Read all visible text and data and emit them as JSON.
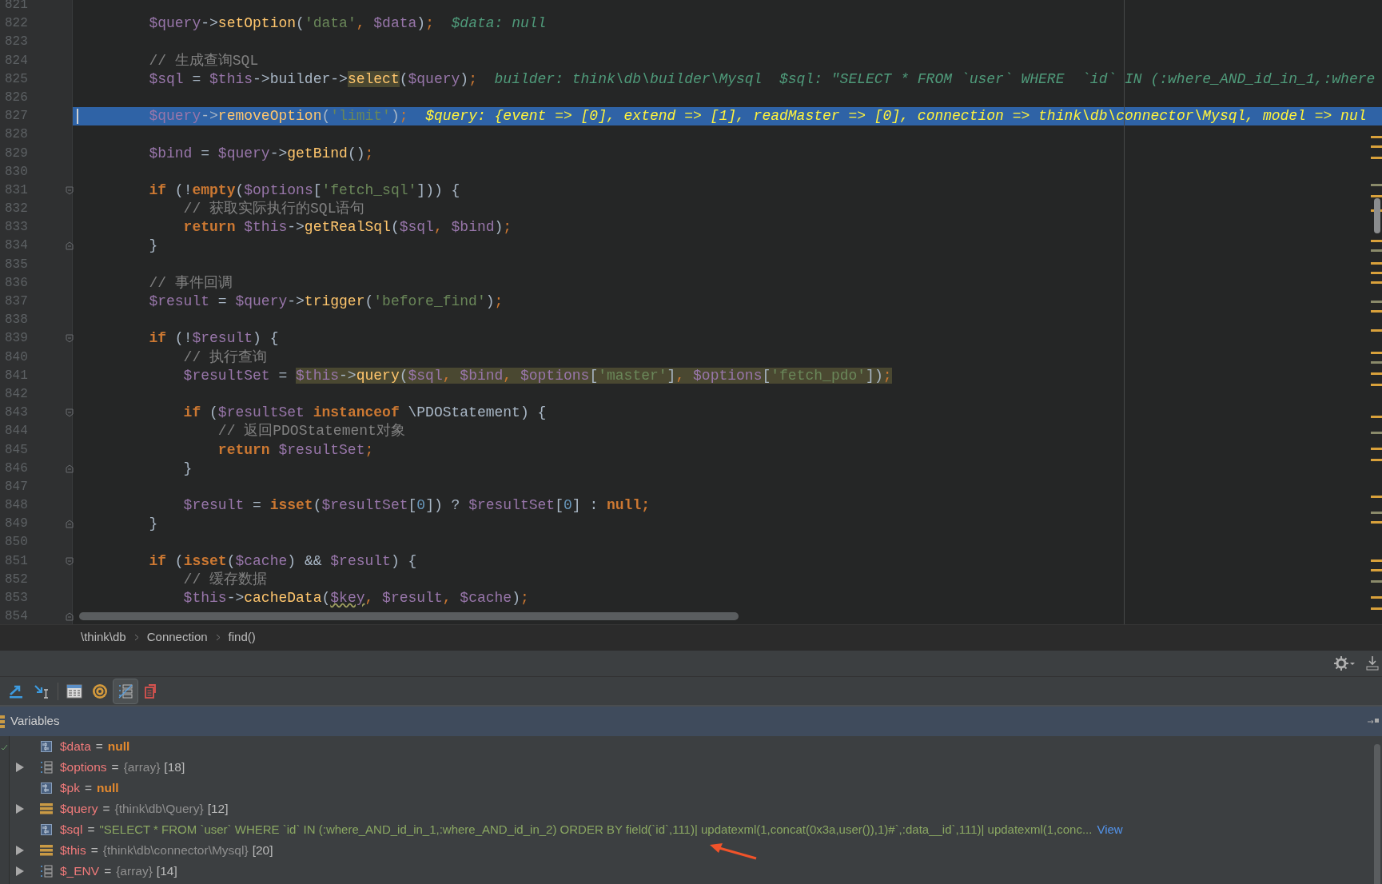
{
  "editor": {
    "lines": [
      {
        "number": "821",
        "current": false,
        "fold_start": false,
        "fold_end": false
      },
      {
        "number": "822",
        "current": false,
        "fold_start": false,
        "fold_end": false,
        "tokens": [
          {
            "kind": "var",
            "text": "        $query"
          },
          {
            "kind": "pl",
            "text": "->"
          },
          {
            "kind": "fn",
            "text": "setOption"
          },
          {
            "kind": "pl",
            "text": "("
          },
          {
            "kind": "str",
            "text": "'data'"
          },
          {
            "kind": "op",
            "text": ", "
          },
          {
            "kind": "var",
            "text": "$data"
          },
          {
            "kind": "pl",
            "text": ")"
          },
          {
            "kind": "op",
            "text": ";"
          }
        ],
        "hint": "$data: null"
      },
      {
        "number": "823",
        "current": false,
        "fold_start": false,
        "fold_end": false
      },
      {
        "number": "824",
        "current": false,
        "fold_start": false,
        "fold_end": false,
        "tokens": [
          {
            "kind": "cm",
            "text": "        // 生成查询SQL"
          }
        ]
      },
      {
        "number": "825",
        "current": false,
        "fold_start": false,
        "fold_end": false,
        "tokens": [
          {
            "kind": "var",
            "text": "        $sql"
          },
          {
            "kind": "pl",
            "text": " = "
          },
          {
            "kind": "var",
            "text": "$this"
          },
          {
            "kind": "pl",
            "text": "->builder->"
          },
          {
            "kind": "highlight",
            "tokens": [
              {
                "kind": "fn",
                "text": "select"
              }
            ]
          },
          {
            "kind": "pl",
            "text": "("
          },
          {
            "kind": "var",
            "text": "$query"
          },
          {
            "kind": "pl",
            "text": ")"
          },
          {
            "kind": "op",
            "text": ";"
          }
        ],
        "hint": "builder: think\\db\\builder\\Mysql  $sql: \"SELECT * FROM `user` WHERE  `id` IN (:where_AND_id_in_1,:where"
      },
      {
        "number": "826",
        "current": false,
        "fold_start": false,
        "fold_end": false
      },
      {
        "number": "827",
        "current": true,
        "fold_start": false,
        "fold_end": false,
        "tokens": [
          {
            "kind": "var",
            "text": "        $query"
          },
          {
            "kind": "pl",
            "text": "->"
          },
          {
            "kind": "fn",
            "text": "removeOption"
          },
          {
            "kind": "pl",
            "text": "("
          },
          {
            "kind": "str",
            "text": "'limit'"
          },
          {
            "kind": "pl",
            "text": ")"
          },
          {
            "kind": "op",
            "text": ";"
          }
        ],
        "hint": "$query: {event => [0], extend => [1], readMaster => [0], connection => think\\db\\connector\\Mysql, model => nul"
      },
      {
        "number": "828",
        "current": false,
        "fold_start": false,
        "fold_end": false
      },
      {
        "number": "829",
        "current": false,
        "fold_start": false,
        "fold_end": false,
        "tokens": [
          {
            "kind": "var",
            "text": "        $bind"
          },
          {
            "kind": "pl",
            "text": " = "
          },
          {
            "kind": "var",
            "text": "$query"
          },
          {
            "kind": "pl",
            "text": "->"
          },
          {
            "kind": "fn",
            "text": "getBind"
          },
          {
            "kind": "pl",
            "text": "()"
          },
          {
            "kind": "op",
            "text": ";"
          }
        ]
      },
      {
        "number": "830",
        "current": false,
        "fold_start": false,
        "fold_end": false
      },
      {
        "number": "831",
        "current": false,
        "fold_start": true,
        "fold_end": false,
        "tokens": [
          {
            "kind": "kw",
            "text": "        if"
          },
          {
            "kind": "pl",
            "text": " (!"
          },
          {
            "kind": "kw",
            "text": "empty"
          },
          {
            "kind": "pl",
            "text": "("
          },
          {
            "kind": "var",
            "text": "$options"
          },
          {
            "kind": "pl",
            "text": "["
          },
          {
            "kind": "str",
            "text": "'fetch_sql'"
          },
          {
            "kind": "pl",
            "text": "])) {"
          }
        ]
      },
      {
        "number": "832",
        "current": false,
        "fold_start": false,
        "fold_end": false,
        "tokens": [
          {
            "kind": "cm",
            "text": "            // 获取实际执行的SQL语句"
          }
        ]
      },
      {
        "number": "833",
        "current": false,
        "fold_start": false,
        "fold_end": false,
        "tokens": [
          {
            "kind": "kw",
            "text": "            return "
          },
          {
            "kind": "var",
            "text": "$this"
          },
          {
            "kind": "pl",
            "text": "->"
          },
          {
            "kind": "fn",
            "text": "getRealSql"
          },
          {
            "kind": "pl",
            "text": "("
          },
          {
            "kind": "var",
            "text": "$sql"
          },
          {
            "kind": "op",
            "text": ", "
          },
          {
            "kind": "var",
            "text": "$bind"
          },
          {
            "kind": "pl",
            "text": ")"
          },
          {
            "kind": "op",
            "text": ";"
          }
        ]
      },
      {
        "number": "834",
        "current": false,
        "fold_start": false,
        "fold_end": true,
        "tokens": [
          {
            "kind": "pl",
            "text": "        }"
          }
        ]
      },
      {
        "number": "835",
        "current": false,
        "fold_start": false,
        "fold_end": false
      },
      {
        "number": "836",
        "current": false,
        "fold_start": false,
        "fold_end": false,
        "tokens": [
          {
            "kind": "cm",
            "text": "        // 事件回调"
          }
        ]
      },
      {
        "number": "837",
        "current": false,
        "fold_start": false,
        "fold_end": false,
        "tokens": [
          {
            "kind": "var",
            "text": "        $result"
          },
          {
            "kind": "pl",
            "text": " = "
          },
          {
            "kind": "var",
            "text": "$query"
          },
          {
            "kind": "pl",
            "text": "->"
          },
          {
            "kind": "fn",
            "text": "trigger"
          },
          {
            "kind": "pl",
            "text": "("
          },
          {
            "kind": "str",
            "text": "'before_find'"
          },
          {
            "kind": "pl",
            "text": ")"
          },
          {
            "kind": "op",
            "text": ";"
          }
        ]
      },
      {
        "number": "838",
        "current": false,
        "fold_start": false,
        "fold_end": false
      },
      {
        "number": "839",
        "current": false,
        "fold_start": true,
        "fold_end": false,
        "tokens": [
          {
            "kind": "kw",
            "text": "        if"
          },
          {
            "kind": "pl",
            "text": " (!"
          },
          {
            "kind": "var",
            "text": "$result"
          },
          {
            "kind": "pl",
            "text": ") {"
          }
        ]
      },
      {
        "number": "840",
        "current": false,
        "fold_start": false,
        "fold_end": false,
        "tokens": [
          {
            "kind": "cm",
            "text": "            // 执行查询"
          }
        ]
      },
      {
        "number": "841",
        "current": false,
        "fold_start": false,
        "fold_end": false,
        "tokens": [
          {
            "kind": "var",
            "text": "            $resultSet"
          },
          {
            "kind": "pl",
            "text": " = "
          },
          {
            "kind": "highlight",
            "tokens": [
              {
                "kind": "var",
                "text": "$this"
              },
              {
                "kind": "pl",
                "text": "->"
              },
              {
                "kind": "fn",
                "text": "query"
              },
              {
                "kind": "pl",
                "text": "("
              },
              {
                "kind": "var",
                "text": "$sql"
              },
              {
                "kind": "op",
                "text": ", "
              },
              {
                "kind": "var",
                "text": "$bind"
              },
              {
                "kind": "op",
                "text": ", "
              },
              {
                "kind": "var",
                "text": "$options"
              },
              {
                "kind": "pl",
                "text": "["
              },
              {
                "kind": "str",
                "text": "'master'"
              },
              {
                "kind": "pl",
                "text": "]"
              },
              {
                "kind": "op",
                "text": ", "
              },
              {
                "kind": "var",
                "text": "$options"
              },
              {
                "kind": "pl",
                "text": "["
              },
              {
                "kind": "str",
                "text": "'fetch_pdo'"
              },
              {
                "kind": "pl",
                "text": "])"
              },
              {
                "kind": "op",
                "text": ";"
              }
            ]
          }
        ]
      },
      {
        "number": "842",
        "current": false,
        "fold_start": false,
        "fold_end": false
      },
      {
        "number": "843",
        "current": false,
        "fold_start": true,
        "fold_end": false,
        "tokens": [
          {
            "kind": "kw",
            "text": "            if"
          },
          {
            "kind": "pl",
            "text": " ("
          },
          {
            "kind": "var",
            "text": "$resultSet"
          },
          {
            "kind": "kw",
            "text": " instanceof "
          },
          {
            "kind": "pl",
            "text": "\\PDOStatement) {"
          }
        ]
      },
      {
        "number": "844",
        "current": false,
        "fold_start": false,
        "fold_end": false,
        "tokens": [
          {
            "kind": "cm",
            "text": "                // 返回PDOStatement对象"
          }
        ]
      },
      {
        "number": "845",
        "current": false,
        "fold_start": false,
        "fold_end": false,
        "tokens": [
          {
            "kind": "kw",
            "text": "                return "
          },
          {
            "kind": "var",
            "text": "$resultSet"
          },
          {
            "kind": "op",
            "text": ";"
          }
        ]
      },
      {
        "number": "846",
        "current": false,
        "fold_start": false,
        "fold_end": true,
        "tokens": [
          {
            "kind": "pl",
            "text": "            }"
          }
        ]
      },
      {
        "number": "847",
        "current": false,
        "fold_start": false,
        "fold_end": false
      },
      {
        "number": "848",
        "current": false,
        "fold_start": false,
        "fold_end": false,
        "tokens": [
          {
            "kind": "var",
            "text": "            $result"
          },
          {
            "kind": "pl",
            "text": " = "
          },
          {
            "kind": "kw",
            "text": "isset"
          },
          {
            "kind": "pl",
            "text": "("
          },
          {
            "kind": "var",
            "text": "$resultSet"
          },
          {
            "kind": "pl",
            "text": "["
          },
          {
            "kind": "num",
            "text": "0"
          },
          {
            "kind": "pl",
            "text": "]) ? "
          },
          {
            "kind": "var",
            "text": "$resultSet"
          },
          {
            "kind": "pl",
            "text": "["
          },
          {
            "kind": "num",
            "text": "0"
          },
          {
            "kind": "pl",
            "text": "] : "
          },
          {
            "kind": "kw",
            "text": "null;"
          }
        ]
      },
      {
        "number": "849",
        "current": false,
        "fold_start": false,
        "fold_end": true,
        "tokens": [
          {
            "kind": "pl",
            "text": "        }"
          }
        ]
      },
      {
        "number": "850",
        "current": false,
        "fold_start": false,
        "fold_end": false
      },
      {
        "number": "851",
        "current": false,
        "fold_start": true,
        "fold_end": false,
        "tokens": [
          {
            "kind": "kw",
            "text": "        if"
          },
          {
            "kind": "pl",
            "text": " ("
          },
          {
            "kind": "kw",
            "text": "isset"
          },
          {
            "kind": "pl",
            "text": "("
          },
          {
            "kind": "var",
            "text": "$cache"
          },
          {
            "kind": "pl",
            "text": ") && "
          },
          {
            "kind": "var",
            "text": "$result"
          },
          {
            "kind": "pl",
            "text": ") {"
          }
        ]
      },
      {
        "number": "852",
        "current": false,
        "fold_start": false,
        "fold_end": false,
        "tokens": [
          {
            "kind": "cm",
            "text": "            // 缓存数据"
          }
        ]
      },
      {
        "number": "853",
        "current": false,
        "fold_start": false,
        "fold_end": false,
        "tokens": [
          {
            "kind": "var",
            "text": "            $this"
          },
          {
            "kind": "pl",
            "text": "->"
          },
          {
            "kind": "fn",
            "text": "cacheData"
          },
          {
            "kind": "pl",
            "text": "("
          },
          {
            "kind": "warn",
            "text": "$key"
          },
          {
            "kind": "op",
            "text": ", "
          },
          {
            "kind": "var",
            "text": "$result"
          },
          {
            "kind": "op",
            "text": ", "
          },
          {
            "kind": "var",
            "text": "$cache"
          },
          {
            "kind": "pl",
            "text": ")"
          },
          {
            "kind": "op",
            "text": ";"
          }
        ]
      },
      {
        "number": "854",
        "current": false,
        "fold_start": false,
        "fold_end": true
      }
    ]
  },
  "breadcrumbs": [
    "\\think\\db",
    "Connection",
    "find()"
  ],
  "debug_toolbar": [
    {
      "selected": false
    },
    {
      "selected": false
    },
    {
      "selected": false
    },
    {
      "selected": false
    },
    {
      "selected": true
    },
    {
      "selected": false
    }
  ],
  "variables": {
    "title": "Variables",
    "rows": [
      {
        "name": "$data",
        "kind": "scalar",
        "expandable": false,
        "operator": "=",
        "value": {
          "kind": "keyword",
          "text": "null"
        }
      },
      {
        "name": "$options",
        "kind": "array",
        "expandable": true,
        "operator": "=",
        "type": "{array}",
        "count": "[18]"
      },
      {
        "name": "$pk",
        "kind": "scalar",
        "expandable": false,
        "operator": "=",
        "value": {
          "kind": "keyword",
          "text": "null"
        }
      },
      {
        "name": "$query",
        "kind": "object",
        "expandable": true,
        "operator": "=",
        "type": "{think\\db\\Query}",
        "count": "[12]"
      },
      {
        "name": "$sql",
        "kind": "scalar",
        "expandable": false,
        "operator": "=",
        "value": {
          "kind": "string",
          "text": "\"SELECT * FROM `user` WHERE  `id` IN (:where_AND_id_in_1,:where_AND_id_in_2) ORDER BY field(`id`,111)| updatexml(1,concat(0x3a,user()),1)#`,:data__id`,111)| updatexml(1,conc..."
        },
        "link": "View"
      },
      {
        "name": "$this",
        "kind": "object",
        "expandable": true,
        "operator": "=",
        "type": "{think\\db\\connector\\Mysql}",
        "count": "[20]"
      },
      {
        "name": "$_ENV",
        "kind": "array",
        "expandable": true,
        "operator": "=",
        "type": "{array}",
        "count": "[14]"
      }
    ]
  }
}
